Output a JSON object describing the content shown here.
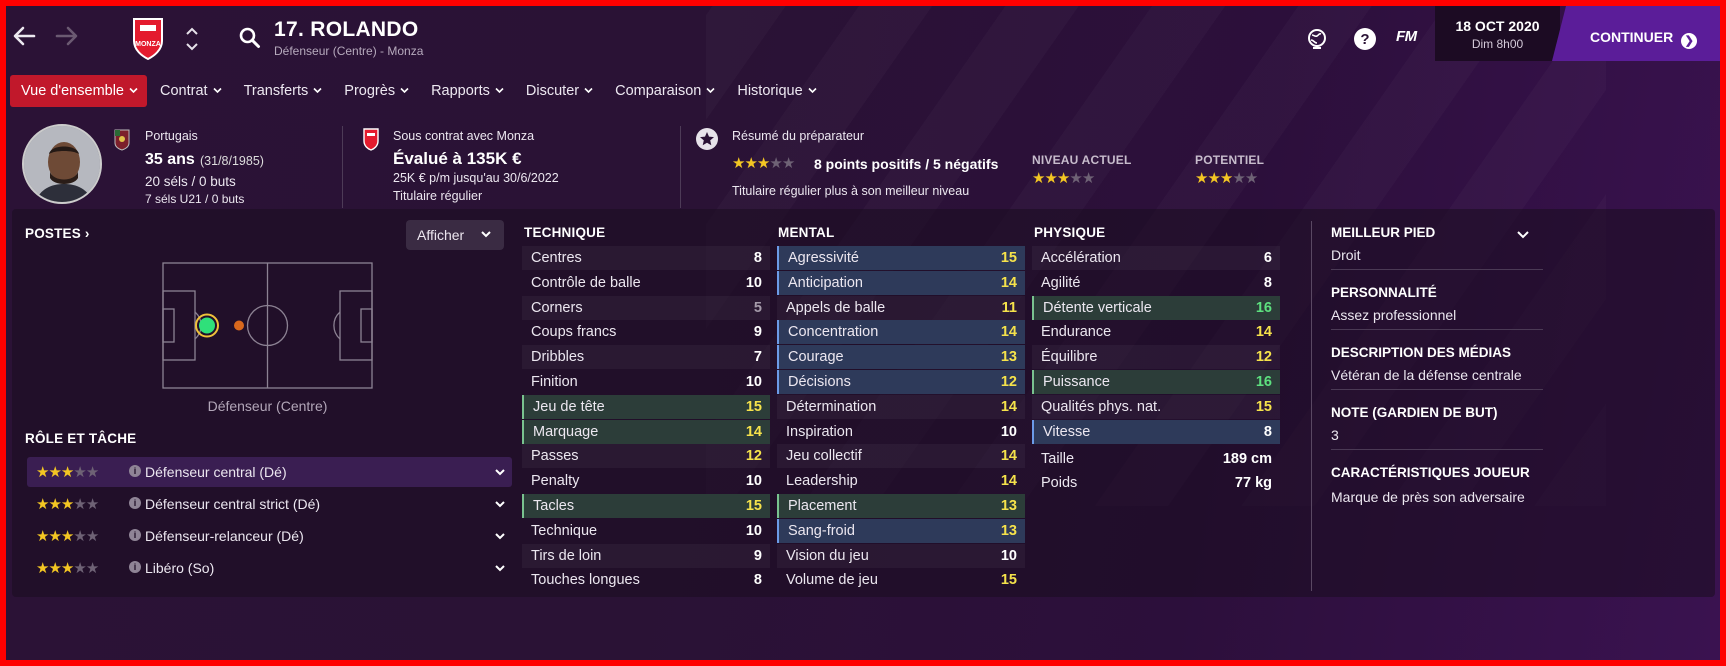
{
  "player": {
    "name": "17. ROLANDO",
    "subtitle": "Défenseur (Centre) - Monza",
    "nationality": "Portugais",
    "age": "35 ans",
    "dob": "(31/8/1985)",
    "caps": "20 séls / 0 buts",
    "u21": "7 séls U21 / 0 buts"
  },
  "contract": {
    "line1": "Sous contrat avec Monza",
    "value": "Évalué à 135K €",
    "wage": "25K € p/m jusqu'au 30/6/2022",
    "status": "Titulaire régulier"
  },
  "coach": {
    "title": "Résumé du préparateur",
    "summary": "8 points positifs / 5 négatifs",
    "note": "Titulaire régulier plus à son meilleur niveau",
    "stars": 3,
    "current_label": "NIVEAU ACTUEL",
    "current_stars": 3,
    "potential_label": "POTENTIEL",
    "potential_stars": 3
  },
  "topbar": {
    "date": "18 OCT 2020",
    "time": "Dim 8h00",
    "continue": "CONTINUER",
    "fm": "FM",
    "icons": [
      "back-arrow-icon",
      "forward-arrow-icon",
      "club-crest-icon",
      "search-icon",
      "world-icon",
      "help-icon"
    ]
  },
  "tabs": [
    {
      "label": "Vue d'ensemble",
      "active": true
    },
    {
      "label": "Contrat"
    },
    {
      "label": "Transferts"
    },
    {
      "label": "Progrès"
    },
    {
      "label": "Rapports"
    },
    {
      "label": "Discuter"
    },
    {
      "label": "Comparaison"
    },
    {
      "label": "Historique"
    }
  ],
  "positions": {
    "title": "POSTES",
    "show_button": "Afficher",
    "position_label": "Défenseur (Centre)"
  },
  "roles": {
    "title": "RÔLE ET TÂCHE",
    "items": [
      {
        "label": "Défenseur central (Dé)",
        "stars": 3
      },
      {
        "label": "Défenseur central strict (Dé)",
        "stars": 3
      },
      {
        "label": "Défenseur-relanceur (Dé)",
        "stars": 3
      },
      {
        "label": "Libéro (So)",
        "stars": 3
      }
    ]
  },
  "technique": {
    "title": "TECHNIQUE",
    "items": [
      {
        "name": "Centres",
        "value": 8
      },
      {
        "name": "Contrôle de balle",
        "value": 10
      },
      {
        "name": "Corners",
        "value": 5
      },
      {
        "name": "Coups francs",
        "value": 9
      },
      {
        "name": "Dribbles",
        "value": 7
      },
      {
        "name": "Finition",
        "value": 10
      },
      {
        "name": "Jeu de tête",
        "value": 15,
        "hl": "green"
      },
      {
        "name": "Marquage",
        "value": 14,
        "hl": "green"
      },
      {
        "name": "Passes",
        "value": 12
      },
      {
        "name": "Penalty",
        "value": 10
      },
      {
        "name": "Tacles",
        "value": 15,
        "hl": "green"
      },
      {
        "name": "Technique",
        "value": 10
      },
      {
        "name": "Tirs de loin",
        "value": 9
      },
      {
        "name": "Touches longues",
        "value": 8
      }
    ]
  },
  "mental": {
    "title": "MENTAL",
    "items": [
      {
        "name": "Agressivité",
        "value": 15,
        "hl": "blue"
      },
      {
        "name": "Anticipation",
        "value": 14,
        "hl": "blue"
      },
      {
        "name": "Appels de balle",
        "value": 11
      },
      {
        "name": "Concentration",
        "value": 14,
        "hl": "blue"
      },
      {
        "name": "Courage",
        "value": 13,
        "hl": "blue"
      },
      {
        "name": "Décisions",
        "value": 12,
        "hl": "blue"
      },
      {
        "name": "Détermination",
        "value": 14
      },
      {
        "name": "Inspiration",
        "value": 10
      },
      {
        "name": "Jeu collectif",
        "value": 14
      },
      {
        "name": "Leadership",
        "value": 14
      },
      {
        "name": "Placement",
        "value": 13,
        "hl": "green"
      },
      {
        "name": "Sang-froid",
        "value": 13,
        "hl": "blue"
      },
      {
        "name": "Vision du jeu",
        "value": 10
      },
      {
        "name": "Volume de jeu",
        "value": 15
      }
    ]
  },
  "physique": {
    "title": "PHYSIQUE",
    "items": [
      {
        "name": "Accélération",
        "value": 6
      },
      {
        "name": "Agilité",
        "value": 8
      },
      {
        "name": "Détente verticale",
        "value": 16,
        "hl": "green"
      },
      {
        "name": "Endurance",
        "value": 14
      },
      {
        "name": "Équilibre",
        "value": 12
      },
      {
        "name": "Puissance",
        "value": 16,
        "hl": "green"
      },
      {
        "name": "Qualités phys. nat.",
        "value": 15
      },
      {
        "name": "Vitesse",
        "value": 8,
        "hl": "blue"
      }
    ],
    "height_label": "Taille",
    "height": "189 cm",
    "weight_label": "Poids",
    "weight": "77 kg"
  },
  "info": {
    "foot_title": "MEILLEUR PIED",
    "foot": "Droit",
    "personality_title": "PERSONNALITÉ",
    "personality": "Assez professionnel",
    "media_title": "DESCRIPTION DES MÉDIAS",
    "media": "Vétéran de la défense centrale",
    "gk_title": "NOTE (GARDIEN DE BUT)",
    "gk": "3",
    "traits_title": "CARACTÉRISTIQUES JOUEUR",
    "traits": "Marque de près son adversaire"
  },
  "colors": {
    "accent_red": "#c1182b",
    "continue_purple": "#5b1d99",
    "star": "#f3c623",
    "value_yellow": "#f5e24b",
    "value_green": "#5de07f",
    "value_grey": "#a49aa9"
  }
}
